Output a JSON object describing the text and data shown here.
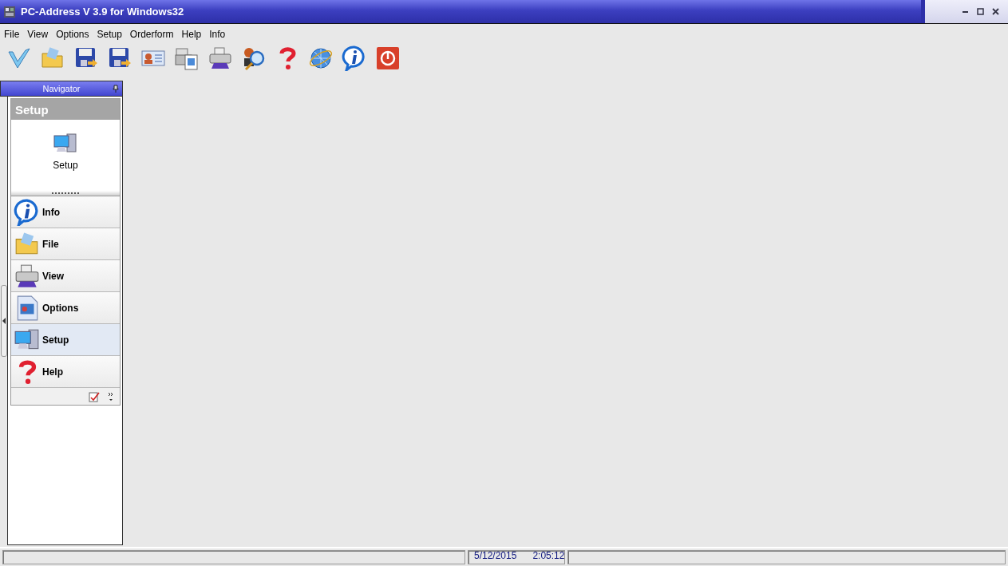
{
  "window": {
    "title": "PC-Address V 3.9 for Windows32"
  },
  "menu": [
    "File",
    "View",
    "Options",
    "Setup",
    "Orderform",
    "Help",
    "Info"
  ],
  "navigator": {
    "title": "Navigator",
    "group_title": "Setup",
    "group_item": "Setup",
    "items": [
      {
        "label": "Info",
        "selected": false
      },
      {
        "label": "File",
        "selected": false
      },
      {
        "label": "View",
        "selected": false
      },
      {
        "label": "Options",
        "selected": false
      },
      {
        "label": "Setup",
        "selected": true
      },
      {
        "label": "Help",
        "selected": false
      }
    ]
  },
  "status_bar": {
    "date": "5/12/2015",
    "time": "2:05:12"
  }
}
